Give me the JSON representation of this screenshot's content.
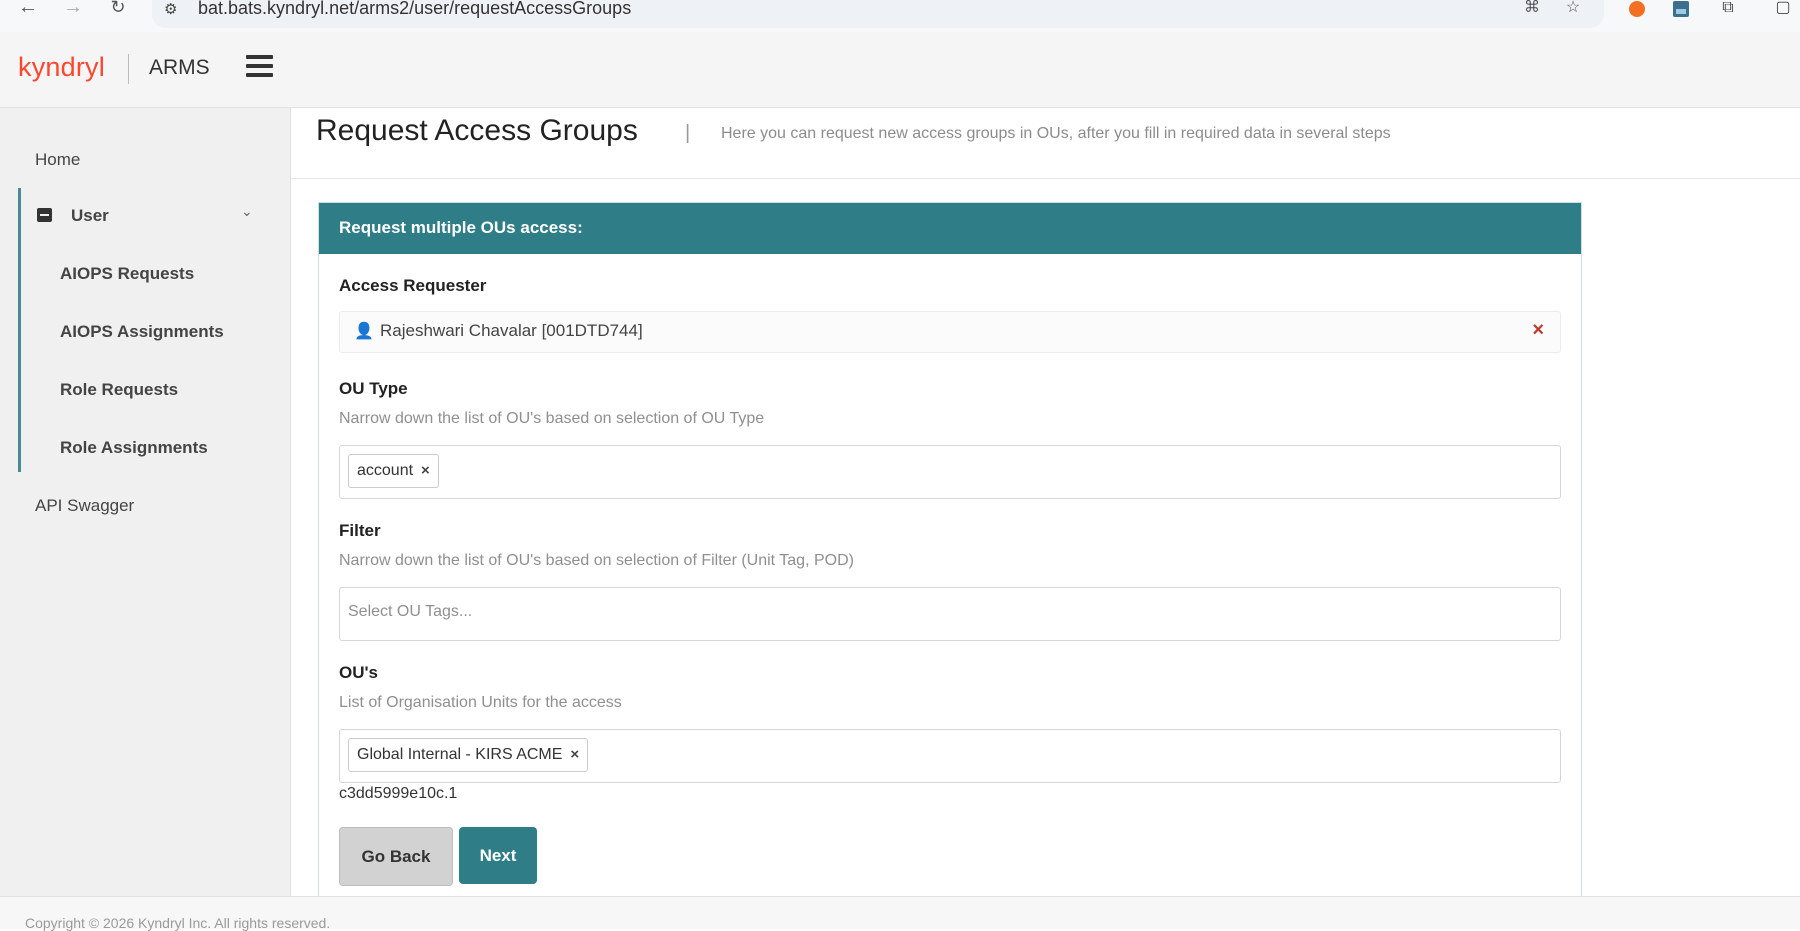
{
  "browser": {
    "url": "bat.bats.kyndryl.net/arms2/user/requestAccessGroups"
  },
  "header": {
    "logo": "kyndryl",
    "app_name": "ARMS"
  },
  "sidebar": {
    "home": "Home",
    "user_group": "User",
    "items": [
      {
        "label": "AIOPS Requests"
      },
      {
        "label": "AIOPS Assignments"
      },
      {
        "label": "Role Requests"
      },
      {
        "label": "Role Assignments"
      }
    ],
    "api": "API Swagger"
  },
  "page": {
    "title": "Request Access Groups",
    "separator": "|",
    "subtitle": "Here you can request new access groups in OUs, after you fill in required data in several steps"
  },
  "panel": {
    "heading": "Request multiple OUs access:",
    "requester": {
      "label": "Access Requester",
      "value": "Rajeshwari Chavalar [001DTD744]"
    },
    "ou_type": {
      "label": "OU Type",
      "help": "Narrow down the list of OU's based on selection of OU Type",
      "tag": "account"
    },
    "filter": {
      "label": "Filter",
      "help": "Narrow down the list of OU's based on selection of Filter (Unit Tag, POD)",
      "placeholder": "Select OU Tags..."
    },
    "ous": {
      "label": "OU's",
      "help": "List of Organisation Units for the access",
      "tag": "Global Internal - KIRS ACME",
      "id": "c3dd5999e10c.1"
    },
    "buttons": {
      "back": "Go Back",
      "next": "Next"
    }
  },
  "footer": {
    "text": "Copyright © 2026 Kyndryl Inc. All rights reserved."
  },
  "colors": {
    "accent": "#2e7d87",
    "brand": "#ff462d",
    "clear": "#c0392b"
  }
}
